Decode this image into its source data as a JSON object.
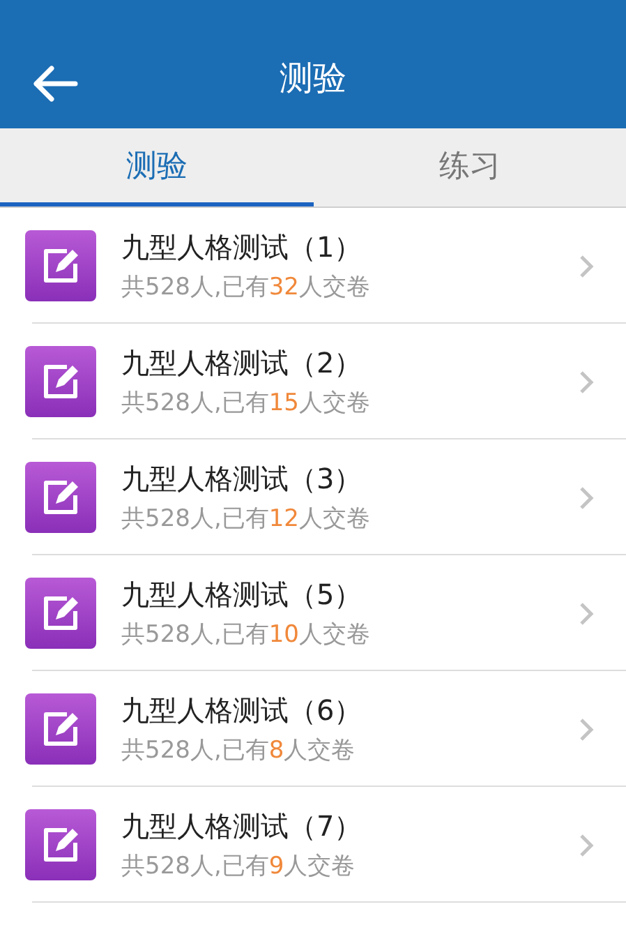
{
  "header": {
    "title": "测验"
  },
  "tabs": [
    {
      "label": "测验",
      "selected": true
    },
    {
      "label": "练习",
      "selected": false
    }
  ],
  "items": [
    {
      "title": "九型人格测试（1）",
      "total": "共528人,已有",
      "count": "32",
      "suffix": "人交卷"
    },
    {
      "title": "九型人格测试（2）",
      "total": "共528人,已有",
      "count": "15",
      "suffix": "人交卷"
    },
    {
      "title": "九型人格测试（3）",
      "total": "共528人,已有",
      "count": "12",
      "suffix": "人交卷"
    },
    {
      "title": "九型人格测试（5）",
      "total": "共528人,已有",
      "count": "10",
      "suffix": "人交卷"
    },
    {
      "title": "九型人格测试（6）",
      "total": "共528人,已有",
      "count": "8",
      "suffix": "人交卷"
    },
    {
      "title": "九型人格测试（7）",
      "total": "共528人,已有",
      "count": "9",
      "suffix": "人交卷"
    }
  ]
}
